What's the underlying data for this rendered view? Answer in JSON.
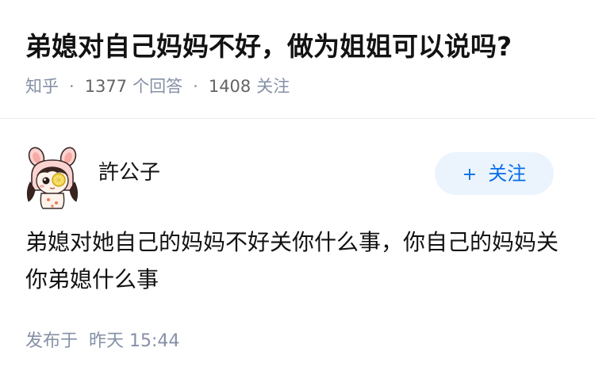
{
  "question": {
    "title": "弟媳对自己妈妈不好，做为姐姐可以说吗?",
    "source": "知乎",
    "answer_count": "1377",
    "answer_label": "个回答",
    "follower_count": "1408",
    "follower_label": "关注",
    "separator": "·"
  },
  "answer": {
    "author": {
      "name": "許公子",
      "avatar_icon": "cartoon-bunny-girl-avatar-icon"
    },
    "follow_button": {
      "icon": "+",
      "label": "关注"
    },
    "content": "弟媳对她自己的妈妈不好关你什么事，你自己的妈妈关你弟媳什么事",
    "published_prefix": "发布于",
    "published_time": "昨天 15:44"
  },
  "colors": {
    "title": "#121212",
    "meta": "#8590a6",
    "follow_bg": "#ebf4fd",
    "follow_text": "#056de8"
  }
}
